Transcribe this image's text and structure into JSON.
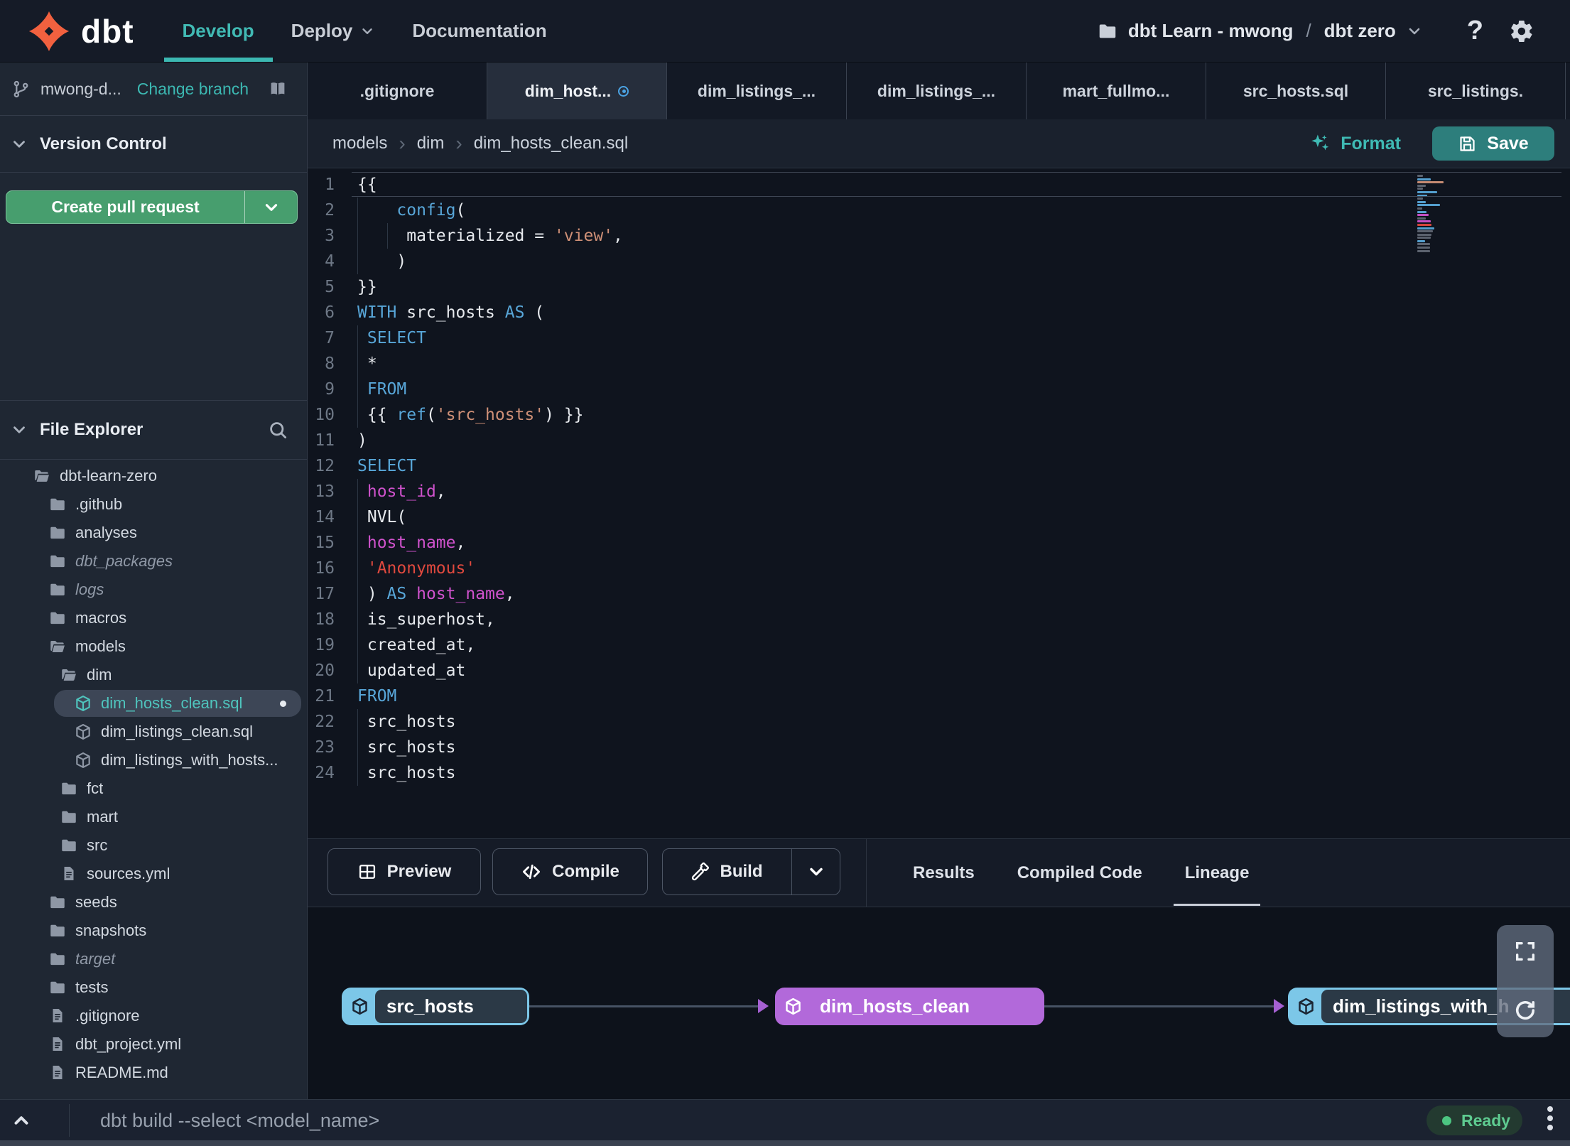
{
  "topnav": {
    "brand": "dbt",
    "nav": [
      {
        "label": "Develop",
        "active": true
      },
      {
        "label": "Deploy",
        "caret": true
      },
      {
        "label": "Documentation"
      }
    ],
    "project": {
      "account": "dbt Learn - mwong",
      "separator": "/",
      "env": "dbt zero"
    },
    "help_label": "?"
  },
  "sidebar": {
    "branch": {
      "name": "mwong-d...",
      "change_link": "Change branch"
    },
    "version_control_label": "Version Control",
    "create_pr_label": "Create pull request",
    "file_explorer_label": "File Explorer",
    "tree": [
      {
        "label": "dbt-learn-zero",
        "type": "folder-open",
        "level": 0
      },
      {
        "label": ".github",
        "type": "folder",
        "level": 1
      },
      {
        "label": "analyses",
        "type": "folder",
        "level": 1
      },
      {
        "label": "dbt_packages",
        "type": "folder",
        "level": 1,
        "italic": true
      },
      {
        "label": "logs",
        "type": "folder",
        "level": 1,
        "italic": true
      },
      {
        "label": "macros",
        "type": "folder",
        "level": 1
      },
      {
        "label": "models",
        "type": "folder-open",
        "level": 1
      },
      {
        "label": "dim",
        "type": "folder-open",
        "level": 2
      },
      {
        "label": "dim_hosts_clean.sql",
        "type": "model",
        "level": 3,
        "selected": true,
        "dirty": true
      },
      {
        "label": "dim_listings_clean.sql",
        "type": "model",
        "level": 3
      },
      {
        "label": "dim_listings_with_hosts...",
        "type": "model",
        "level": 3
      },
      {
        "label": "fct",
        "type": "folder",
        "level": 2
      },
      {
        "label": "mart",
        "type": "folder",
        "level": 2
      },
      {
        "label": "src",
        "type": "folder",
        "level": 2
      },
      {
        "label": "sources.yml",
        "type": "file",
        "level": 2
      },
      {
        "label": "seeds",
        "type": "folder",
        "level": 1
      },
      {
        "label": "snapshots",
        "type": "folder",
        "level": 1
      },
      {
        "label": "target",
        "type": "folder",
        "level": 1,
        "italic": true
      },
      {
        "label": "tests",
        "type": "folder",
        "level": 1
      },
      {
        "label": ".gitignore",
        "type": "file",
        "level": 1
      },
      {
        "label": "dbt_project.yml",
        "type": "file",
        "level": 1
      },
      {
        "label": "README.md",
        "type": "file",
        "level": 1
      }
    ]
  },
  "tabs": {
    "items": [
      {
        "label": ".gitignore"
      },
      {
        "label": "dim_host...",
        "active": true,
        "modified": true
      },
      {
        "label": "dim_listings_..."
      },
      {
        "label": "dim_listings_..."
      },
      {
        "label": "mart_fullmo..."
      },
      {
        "label": "src_hosts.sql"
      },
      {
        "label": "src_listings."
      }
    ],
    "new_tab": "+"
  },
  "editor": {
    "breadcrumb": [
      "models",
      "dim",
      "dim_hosts_clean.sql"
    ],
    "format_label": "Format",
    "save_label": "Save",
    "code": [
      {
        "n": 1,
        "active": true,
        "guides": [],
        "segs": [
          [
            "{{",
            "p"
          ]
        ]
      },
      {
        "n": 2,
        "guides": [
          70
        ],
        "segs": [
          [
            "    ",
            "p"
          ],
          [
            "config",
            "k"
          ],
          [
            "(",
            "p"
          ]
        ]
      },
      {
        "n": 3,
        "guides": [
          70,
          112
        ],
        "segs": [
          [
            "     materialized = ",
            "p"
          ],
          [
            "'view'",
            "s"
          ],
          [
            ",",
            "p"
          ]
        ]
      },
      {
        "n": 4,
        "guides": [
          70
        ],
        "segs": [
          [
            "    )",
            "p"
          ]
        ]
      },
      {
        "n": 5,
        "guides": [],
        "segs": [
          [
            "}}",
            "p"
          ]
        ]
      },
      {
        "n": 6,
        "guides": [],
        "segs": [
          [
            "WITH",
            "k"
          ],
          [
            " src_hosts ",
            "p"
          ],
          [
            "AS",
            "k"
          ],
          [
            " (",
            "p"
          ]
        ]
      },
      {
        "n": 7,
        "guides": [
          70
        ],
        "segs": [
          [
            " ",
            "p"
          ],
          [
            "SELECT",
            "k"
          ]
        ]
      },
      {
        "n": 8,
        "guides": [
          70
        ],
        "segs": [
          [
            " *",
            "p"
          ]
        ]
      },
      {
        "n": 9,
        "guides": [
          70
        ],
        "segs": [
          [
            " ",
            "p"
          ],
          [
            "FROM",
            "k"
          ]
        ]
      },
      {
        "n": 10,
        "guides": [
          70
        ],
        "segs": [
          [
            " {{ ",
            "p"
          ],
          [
            "ref",
            "k"
          ],
          [
            "(",
            "p"
          ],
          [
            "'src_hosts'",
            "s"
          ],
          [
            ") }}",
            "p"
          ]
        ]
      },
      {
        "n": 11,
        "guides": [],
        "segs": [
          [
            ")",
            "p"
          ]
        ]
      },
      {
        "n": 12,
        "guides": [],
        "segs": [
          [
            "SELECT",
            "k"
          ]
        ]
      },
      {
        "n": 13,
        "guides": [
          70
        ],
        "segs": [
          [
            " ",
            "p"
          ],
          [
            "host_id",
            "i"
          ],
          [
            ",",
            "p"
          ]
        ]
      },
      {
        "n": 14,
        "guides": [
          70
        ],
        "segs": [
          [
            " NVL(",
            "p"
          ]
        ]
      },
      {
        "n": 15,
        "guides": [
          70
        ],
        "segs": [
          [
            " ",
            "p"
          ],
          [
            "host_name",
            "i"
          ],
          [
            ",",
            "p"
          ]
        ]
      },
      {
        "n": 16,
        "guides": [
          70
        ],
        "segs": [
          [
            " ",
            "p"
          ],
          [
            "'Anonymous'",
            "r"
          ]
        ]
      },
      {
        "n": 17,
        "guides": [
          70
        ],
        "segs": [
          [
            " ) ",
            "p"
          ],
          [
            "AS",
            "k"
          ],
          [
            " ",
            "p"
          ],
          [
            "host_name",
            "i"
          ],
          [
            ",",
            "p"
          ]
        ]
      },
      {
        "n": 18,
        "guides": [
          70
        ],
        "segs": [
          [
            " is_superhost,",
            "p"
          ]
        ]
      },
      {
        "n": 19,
        "guides": [
          70
        ],
        "segs": [
          [
            " created_at,",
            "p"
          ]
        ]
      },
      {
        "n": 20,
        "guides": [
          70
        ],
        "segs": [
          [
            " updated_at",
            "p"
          ]
        ]
      },
      {
        "n": 21,
        "guides": [],
        "segs": [
          [
            "FROM",
            "k"
          ]
        ]
      },
      {
        "n": 22,
        "guides": [
          70
        ],
        "segs": [
          [
            " src_hosts",
            "p"
          ]
        ]
      },
      {
        "n": 23,
        "guides": [
          70
        ],
        "segs": [
          [
            " src_hosts",
            "p"
          ]
        ]
      },
      {
        "n": 24,
        "guides": [
          70
        ],
        "segs": [
          [
            " src_hosts",
            "p"
          ]
        ]
      }
    ]
  },
  "bottom_panel": {
    "actions": [
      {
        "label": "Preview",
        "icon": "table-icon"
      },
      {
        "label": "Compile",
        "icon": "code-icon"
      },
      {
        "label": "Build",
        "icon": "hammer-icon",
        "split": true
      }
    ],
    "tabs": [
      {
        "label": "Results"
      },
      {
        "label": "Compiled Code"
      },
      {
        "label": "Lineage",
        "active": true
      }
    ],
    "lineage": {
      "nodes": [
        {
          "label": "src_hosts",
          "style": "source"
        },
        {
          "label": "dim_hosts_clean",
          "style": "model"
        },
        {
          "label": "dim_listings_with_h",
          "style": "source"
        }
      ],
      "colors": {
        "source": "#7cc7e8",
        "model": "#b269da"
      }
    }
  },
  "command_bar": {
    "placeholder": "dbt build --select <model_name>",
    "status": "Ready"
  },
  "colors": {
    "accent_teal": "#3cb8b2",
    "pr_green": "#479e6e",
    "save_teal": "#2d7e7c",
    "node_purple": "#b269da",
    "node_cyan": "#7cc7e8",
    "ready_green": "#5ecb90",
    "modified_blue": "#4ba3e3",
    "keyword_blue": "#58a6d8",
    "string_salmon": "#cf9077",
    "string_red": "#e0493e",
    "ident_magenta": "#cf52cc"
  }
}
